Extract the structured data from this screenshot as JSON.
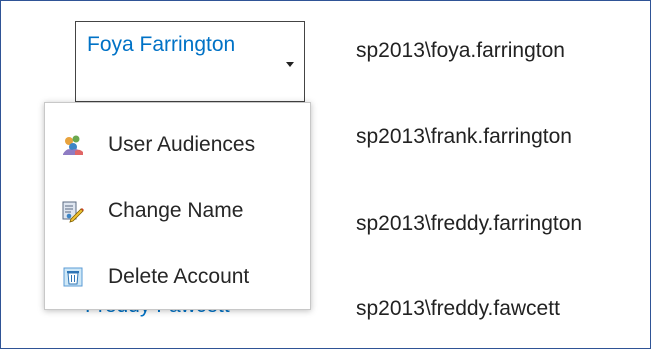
{
  "selected_user": {
    "name": "Foya Farrington",
    "account": "sp2013\\foya.farrington"
  },
  "rows": [
    {
      "account": "sp2013\\frank.farrington"
    },
    {
      "account": "sp2013\\freddy.farrington"
    },
    {
      "name": "Freddy Fawcett",
      "account": "sp2013\\freddy.fawcett"
    }
  ],
  "menu": {
    "items": [
      {
        "label": "User Audiences",
        "icon": "user-audiences-icon"
      },
      {
        "label": "Change Name",
        "icon": "change-name-icon"
      },
      {
        "label": "Delete Account",
        "icon": "delete-account-icon"
      }
    ]
  },
  "colors": {
    "link": "#0072c6",
    "border": "#2f5496"
  }
}
